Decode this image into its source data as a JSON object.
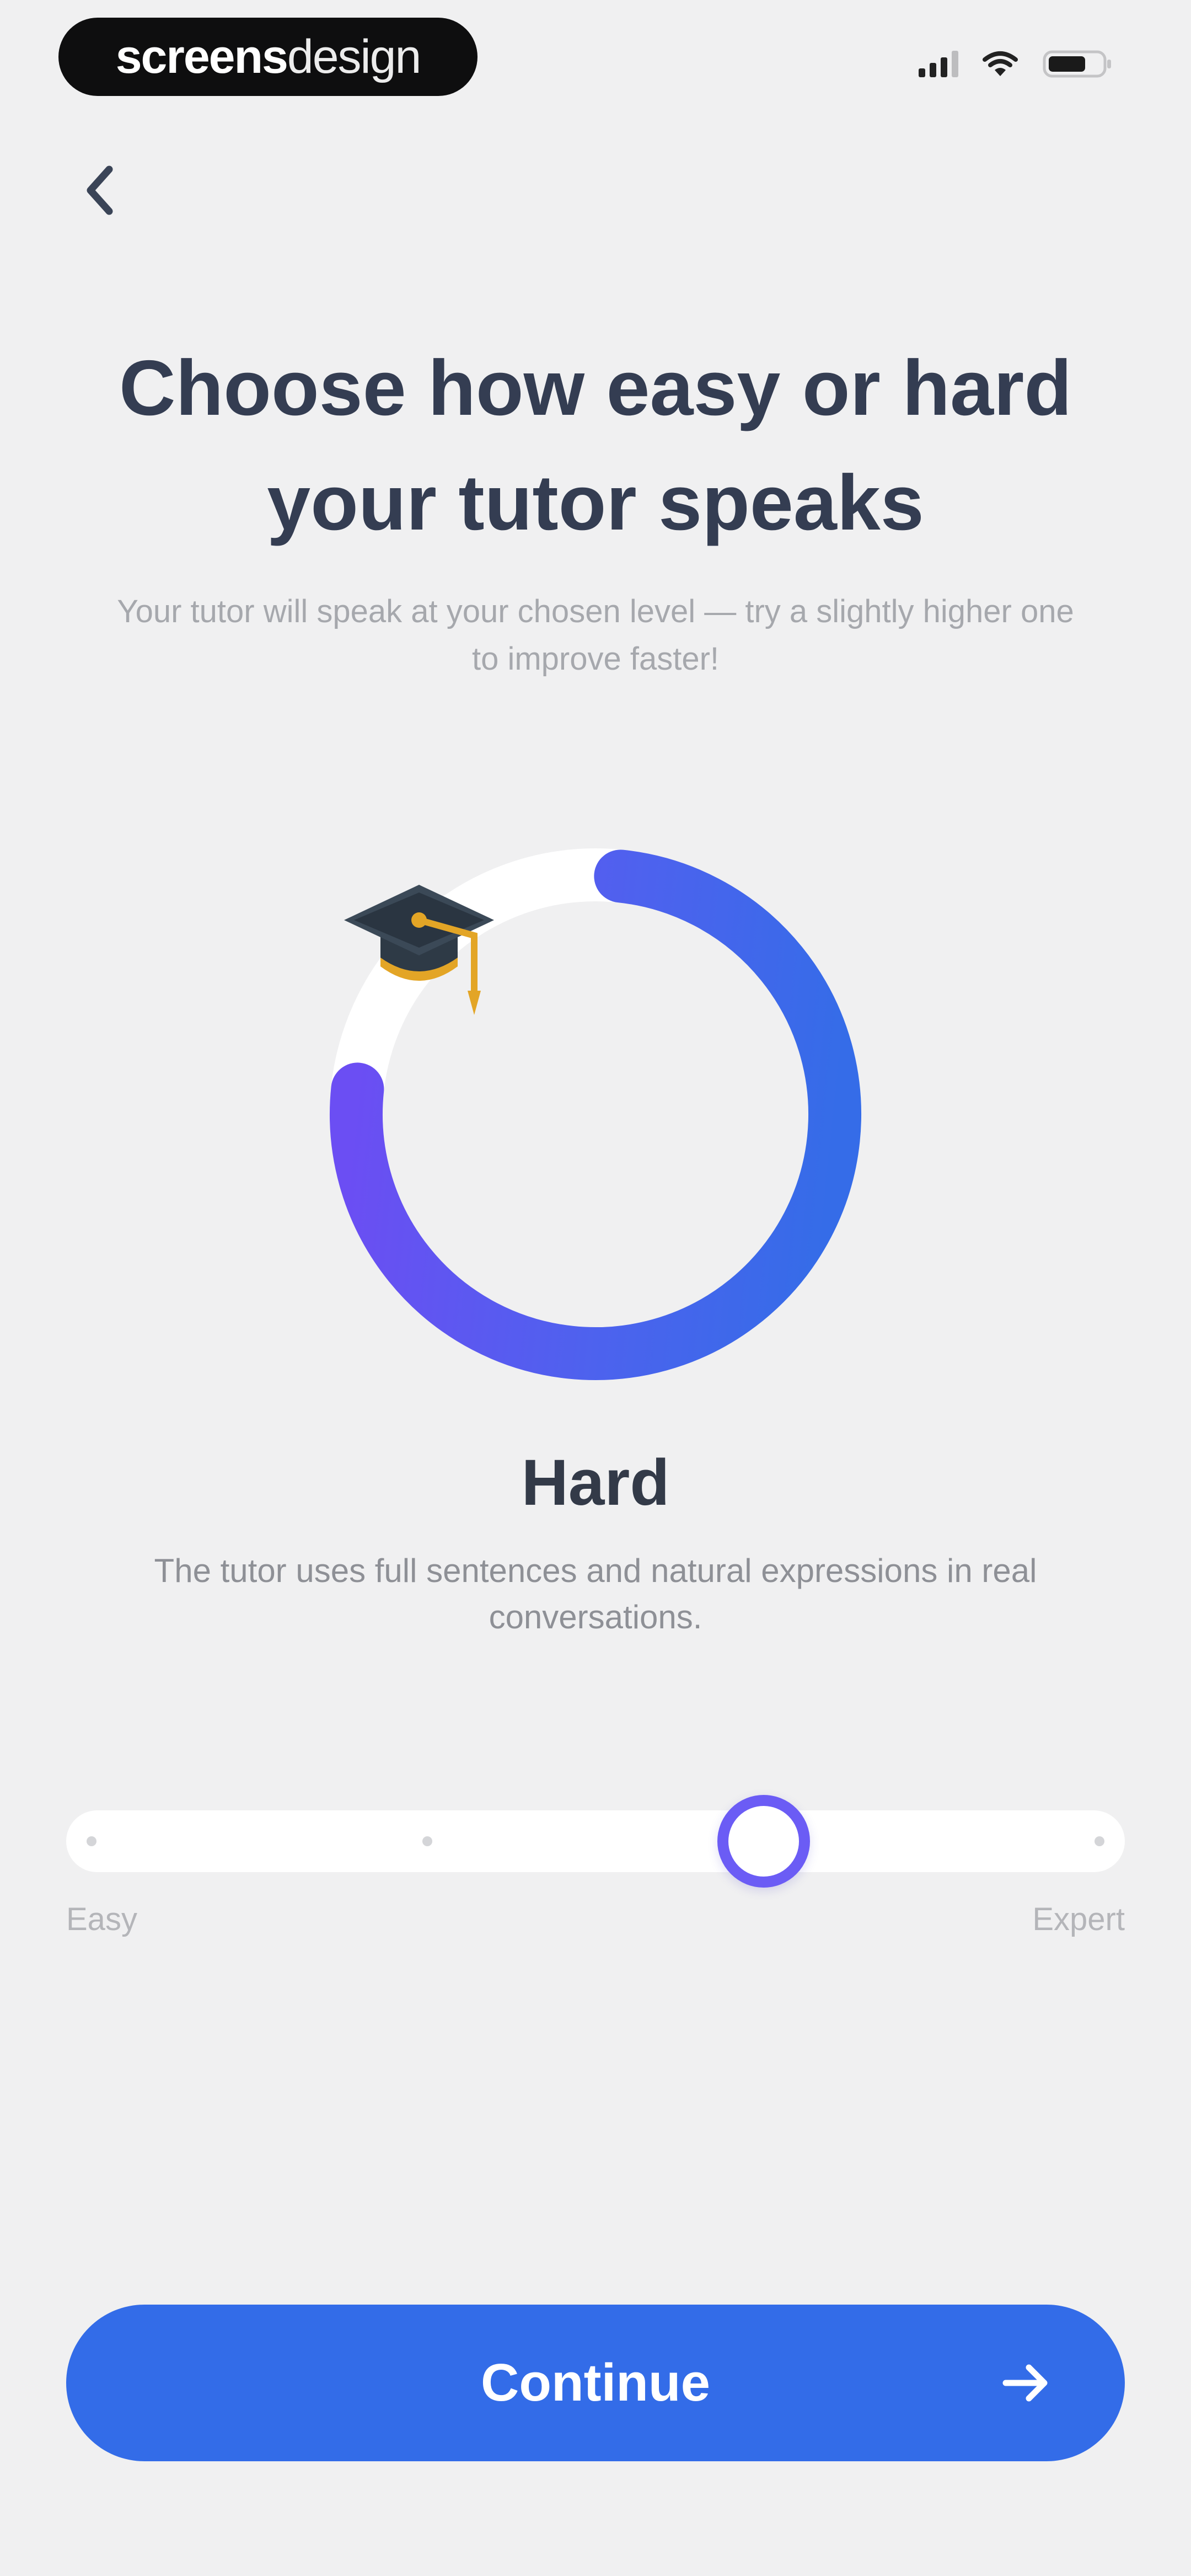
{
  "status_bar": {
    "brand_bold": "screens",
    "brand_light": "design"
  },
  "page": {
    "title": "Choose how easy or hard your tutor speaks",
    "subtitle": "Your tutor will speak at your chosen level — try a slightly higher one to improve faster!"
  },
  "level": {
    "name": "Hard",
    "description": "The tutor uses full sentences and natural expressions in real conversations.",
    "icon": "graduation-cap-icon",
    "ring_progress": 0.75
  },
  "slider": {
    "min_label": "Easy",
    "max_label": "Expert",
    "steps": 4,
    "value_index": 2
  },
  "actions": {
    "continue_label": "Continue"
  },
  "colors": {
    "background": "#f0f0f1",
    "accent_blue": "#336ce8",
    "accent_purple": "#6b5cf5",
    "ring_track": "#ffffff"
  }
}
